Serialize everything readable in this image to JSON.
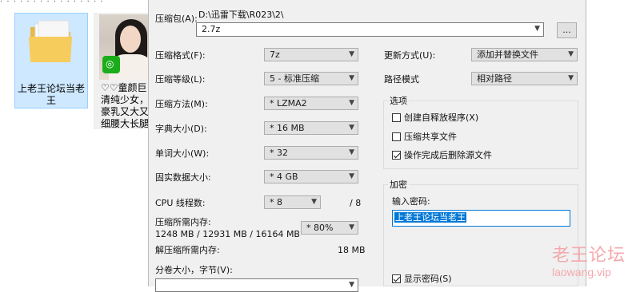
{
  "explorer": {
    "breadcrumb": "· · · · · · · · · · · · · · · ·",
    "folder_tile": {
      "label": "上老王论坛当老王",
      "icon": "folder-icon"
    },
    "image_tile": {
      "lines": [
        "♡♡童颜巨",
        "清纯少女，",
        "豪乳又大又挺",
        "细腰大长腿"
      ]
    }
  },
  "dialog": {
    "archive": {
      "label": "压缩包(A):",
      "path": "D:\\迅雷下载\\R023\\2\\",
      "filename": "2.7z",
      "browse_label": "..."
    },
    "left": {
      "format": {
        "label": "压缩格式(F):",
        "value": "7z"
      },
      "level": {
        "label": "压缩等级(L):",
        "value": "5 - 标准压缩"
      },
      "method": {
        "label": "压缩方法(M):",
        "value": "* LZMA2"
      },
      "dict": {
        "label": "字典大小(D):",
        "value": "* 16 MB"
      },
      "word": {
        "label": "单词大小(W):",
        "value": "* 32"
      },
      "solid": {
        "label": "固实数据大小:",
        "value": "* 4 GB"
      },
      "threads": {
        "label": "CPU 线程数:",
        "value": "* 8",
        "max": "/ 8"
      },
      "mem_compress": {
        "label": "压缩所需内存:",
        "detail": "1248 MB / 12931 MB / 16164 MB",
        "value": "* 80%"
      },
      "mem_decompress": {
        "label": "解压缩所需内存:",
        "value": "18 MB"
      },
      "split": {
        "label": "分卷大小，字节(V):",
        "value": ""
      }
    },
    "right": {
      "update": {
        "label": "更新方式(U):",
        "value": "添加并替换文件"
      },
      "pathmode": {
        "label": "路径模式",
        "value": "相对路径"
      },
      "options": {
        "title": "选项",
        "sfx": {
          "label": "创建自释放程序(X)",
          "checked": false
        },
        "shared": {
          "label": "压缩共享文件",
          "checked": false
        },
        "delete": {
          "label": "操作完成后删除源文件",
          "checked": true
        }
      },
      "encryption": {
        "title": "加密",
        "password_label": "输入密码:",
        "password_value": "上老王论坛当老王",
        "show_password": {
          "label": "显示密码(S)",
          "checked": true
        }
      }
    }
  },
  "watermark": {
    "title": "老王论坛",
    "url": "laowang.vip"
  }
}
